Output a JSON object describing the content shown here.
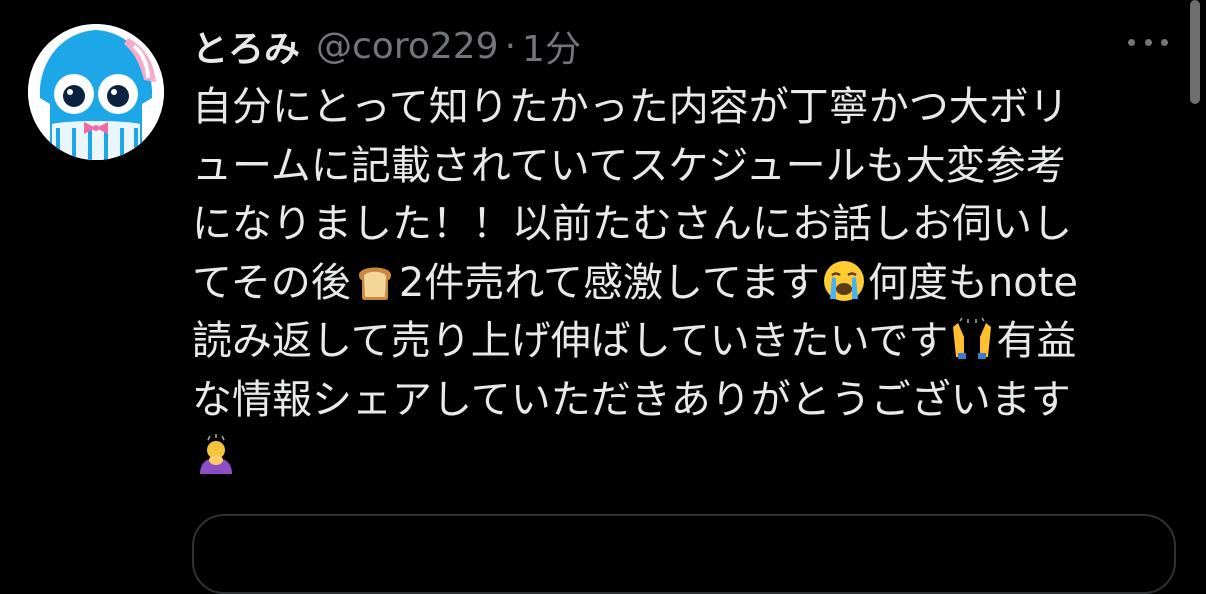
{
  "tweet": {
    "author": {
      "display_name": "とろみ",
      "handle": "@coro229",
      "separator": "·",
      "timestamp": "1分",
      "avatar_icon": "squid-avatar-icon"
    },
    "text_lines": [
      [
        "自分にとって知りたかった内容が丁寧かつ大ボリ"
      ],
      [
        "ュームに記載されていてスケジュールも大変参考"
      ],
      [
        "になりました！！以前たむさんにお話しお伺いし"
      ],
      [
        "てその後",
        "2件売れて感激してます",
        "何度もnote"
      ],
      [
        "読み返して売り上げ伸ばしていきたいです",
        "有益"
      ],
      [
        "な情報シェアしていただきありがとうございます"
      ],
      [
        ""
      ]
    ],
    "emojis": [
      "bread-emoji",
      "crying-face-emoji",
      "raised-hands-emoji",
      "bowing-person-emoji"
    ],
    "more_icon": "more-options-icon"
  },
  "colors": {
    "background": "#000000",
    "primary_text": "#e7e9ea",
    "secondary_text": "#71767b",
    "border": "#2f3336"
  }
}
